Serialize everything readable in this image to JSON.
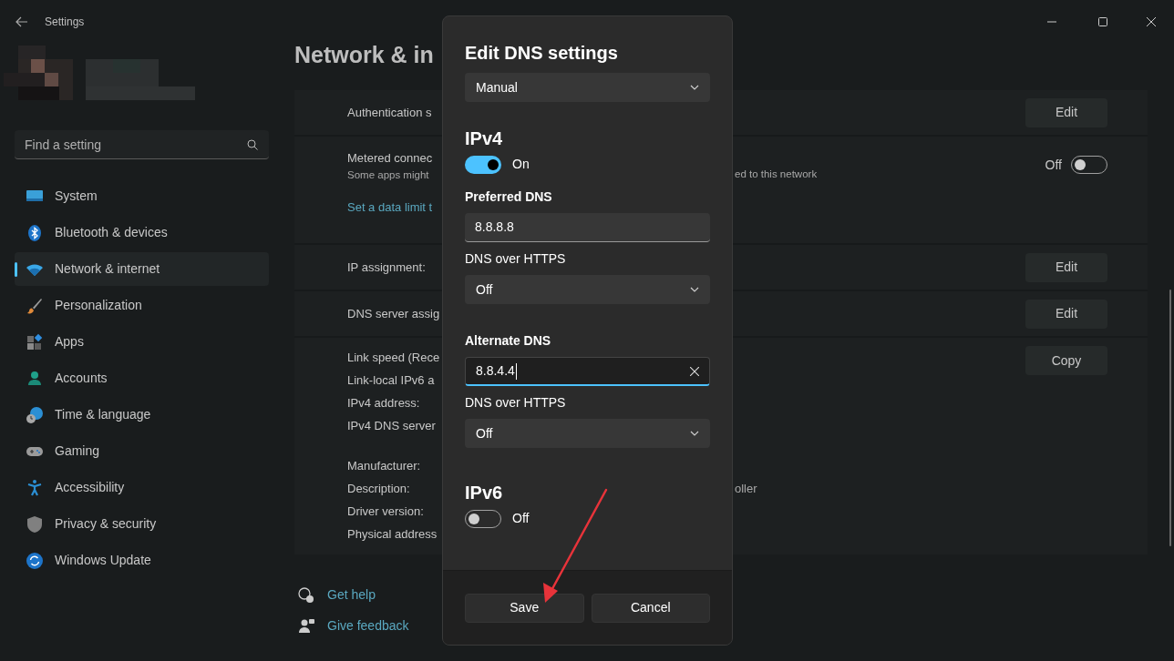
{
  "window": {
    "title": "Settings"
  },
  "sidebar": {
    "search": {
      "placeholder": "Find a setting"
    },
    "items": [
      {
        "label": "System",
        "kind": "system",
        "selected": false
      },
      {
        "label": "Bluetooth & devices",
        "kind": "bluetooth",
        "selected": false
      },
      {
        "label": "Network & internet",
        "kind": "network",
        "selected": true
      },
      {
        "label": "Personalization",
        "kind": "brush",
        "selected": false
      },
      {
        "label": "Apps",
        "kind": "apps",
        "selected": false
      },
      {
        "label": "Accounts",
        "kind": "person",
        "selected": false
      },
      {
        "label": "Time & language",
        "kind": "time",
        "selected": false
      },
      {
        "label": "Gaming",
        "kind": "gaming",
        "selected": false
      },
      {
        "label": "Accessibility",
        "kind": "accessibility",
        "selected": false
      },
      {
        "label": "Privacy & security",
        "kind": "shield",
        "selected": false
      },
      {
        "label": "Windows Update",
        "kind": "update",
        "selected": false
      }
    ]
  },
  "page": {
    "title": "Network & in",
    "rows": [
      {
        "kind": "button",
        "label": "Authentication s",
        "button": "Edit"
      },
      {
        "kind": "toggle",
        "label": "Metered connec",
        "description": "Some apps might ",
        "description_rest": "ed to this network",
        "link": "Set a data limit t",
        "toggle": {
          "on": false,
          "label": "Off"
        }
      },
      {
        "kind": "button",
        "label": "IP assignment:",
        "button": "Edit"
      },
      {
        "kind": "button",
        "label": "DNS server assig",
        "button": "Edit"
      },
      {
        "kind": "details",
        "button": "Copy",
        "groups": [
          [
            {
              "label": "Link speed (Rece"
            },
            {
              "label": "Link-local IPv6 a"
            },
            {
              "label": "IPv4 address:"
            },
            {
              "label": "IPv4 DNS server"
            }
          ],
          [
            {
              "label": "Manufacturer:"
            },
            {
              "label": "Description:",
              "value": "oller"
            },
            {
              "label": "Driver version:"
            },
            {
              "label": "Physical address"
            }
          ]
        ]
      }
    ],
    "links": [
      {
        "label": "Get help",
        "kind": "help"
      },
      {
        "label": "Give feedback",
        "kind": "feedback"
      }
    ]
  },
  "dialog": {
    "title": "Edit DNS settings",
    "mode": "Manual",
    "ipv4": {
      "heading": "IPv4",
      "on": true,
      "state": "On",
      "entries": [
        {
          "label": "Preferred DNS",
          "value": "8.8.8.8",
          "focused": false,
          "doh_label": "DNS over HTTPS",
          "doh_value": "Off"
        },
        {
          "label": "Alternate DNS",
          "value": "8.8.4.4",
          "focused": true,
          "doh_label": "DNS over HTTPS",
          "doh_value": "Off"
        }
      ]
    },
    "ipv6": {
      "heading": "IPv6",
      "on": false,
      "state": "Off"
    },
    "buttons": [
      "Save",
      "Cancel"
    ]
  }
}
